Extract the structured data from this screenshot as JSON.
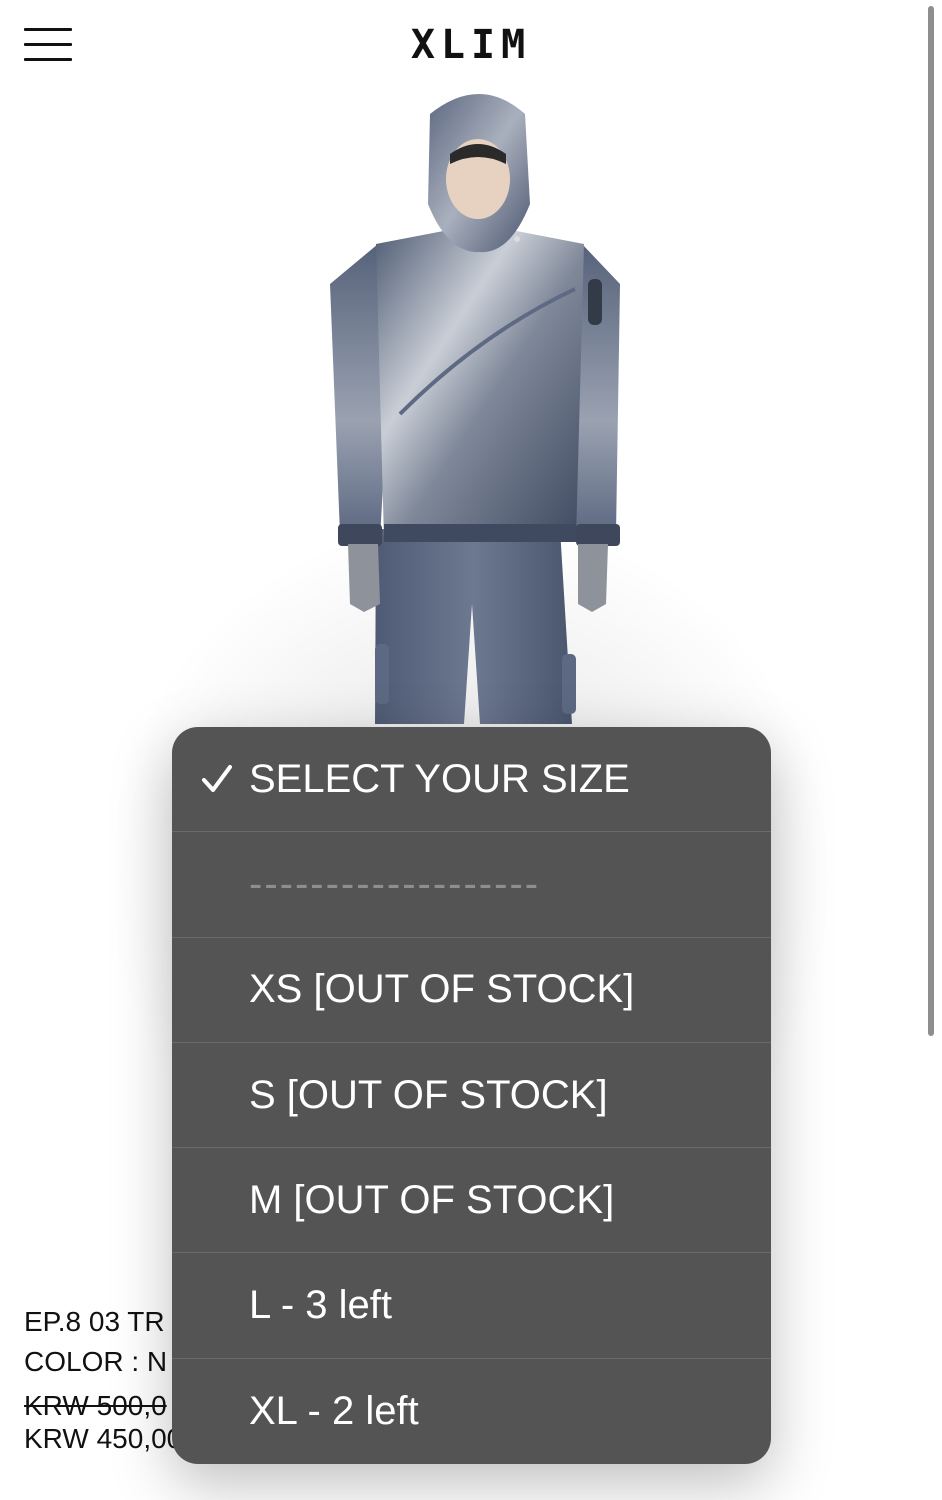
{
  "header": {
    "logo": "XLIM",
    "menu_icon": "hamburger-menu-icon"
  },
  "product": {
    "title": "EP.8 03 TR",
    "color_line": "COLOR : N",
    "price_original": "KRW 500,0",
    "price_sale": "KRW 450,00"
  },
  "size_select": {
    "selected_index": 0,
    "check_icon": "checkmark-icon",
    "options": [
      "SELECT YOUR SIZE",
      "-------------------",
      "XS [OUT OF STOCK]",
      "S [OUT OF STOCK]",
      "M [OUT OF STOCK]",
      "L - 3 left",
      "XL - 2 left"
    ]
  },
  "colors": {
    "dropdown_bg": "#545454",
    "dropdown_text": "#ffffff",
    "separator_text": "#8e8e8e",
    "page_bg": "#ffffff"
  }
}
